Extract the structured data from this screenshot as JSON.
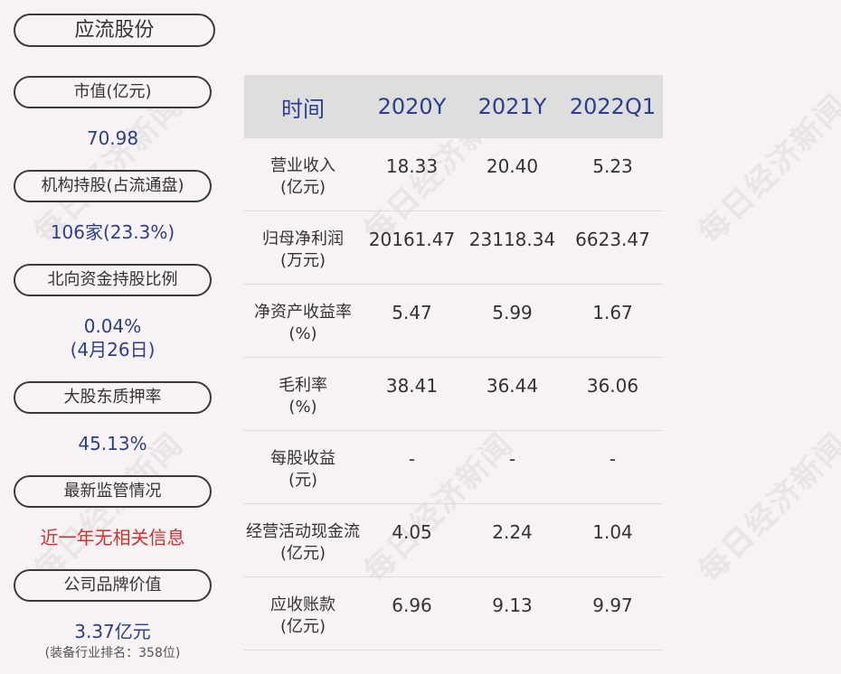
{
  "watermark": "每日经济新闻",
  "company": "应流股份",
  "metrics": [
    {
      "label": "市值(亿元)",
      "value": "70.98"
    },
    {
      "label": "机构持股(占流通盘)",
      "value": "106家(23.3%)"
    },
    {
      "label": "北向资金持股比例",
      "value": "0.04%",
      "value2": "(4月26日)"
    },
    {
      "label": "大股东质押率",
      "value": "45.13%"
    },
    {
      "label": "最新监管情况",
      "value": "近一年无相关信息"
    },
    {
      "label": "公司品牌价值",
      "value": "3.37亿元",
      "note": "(装备行业排名：358位)"
    }
  ],
  "table": {
    "headers": [
      "时间",
      "2020Y",
      "2021Y",
      "2022Q1"
    ],
    "rows": [
      {
        "name": "营业收入",
        "unit": "(亿元)",
        "values": [
          "18.33",
          "20.40",
          "5.23"
        ]
      },
      {
        "name": "归母净利润",
        "unit": "(万元)",
        "values": [
          "20161.47",
          "23118.34",
          "6623.47"
        ]
      },
      {
        "name": "净资产收益率",
        "unit": "(%)",
        "values": [
          "5.47",
          "5.99",
          "1.67"
        ]
      },
      {
        "name": "毛利率",
        "unit": "(%)",
        "values": [
          "38.41",
          "36.44",
          "36.06"
        ]
      },
      {
        "name": "每股收益",
        "unit": "(元)",
        "values": [
          "-",
          "-",
          "-"
        ]
      },
      {
        "name": "经营活动现金流",
        "unit": "(亿元)",
        "values": [
          "4.05",
          "2.24",
          "1.04"
        ]
      },
      {
        "name": "应收账款",
        "unit": "(亿元)",
        "values": [
          "6.96",
          "9.13",
          "9.97"
        ]
      }
    ]
  }
}
